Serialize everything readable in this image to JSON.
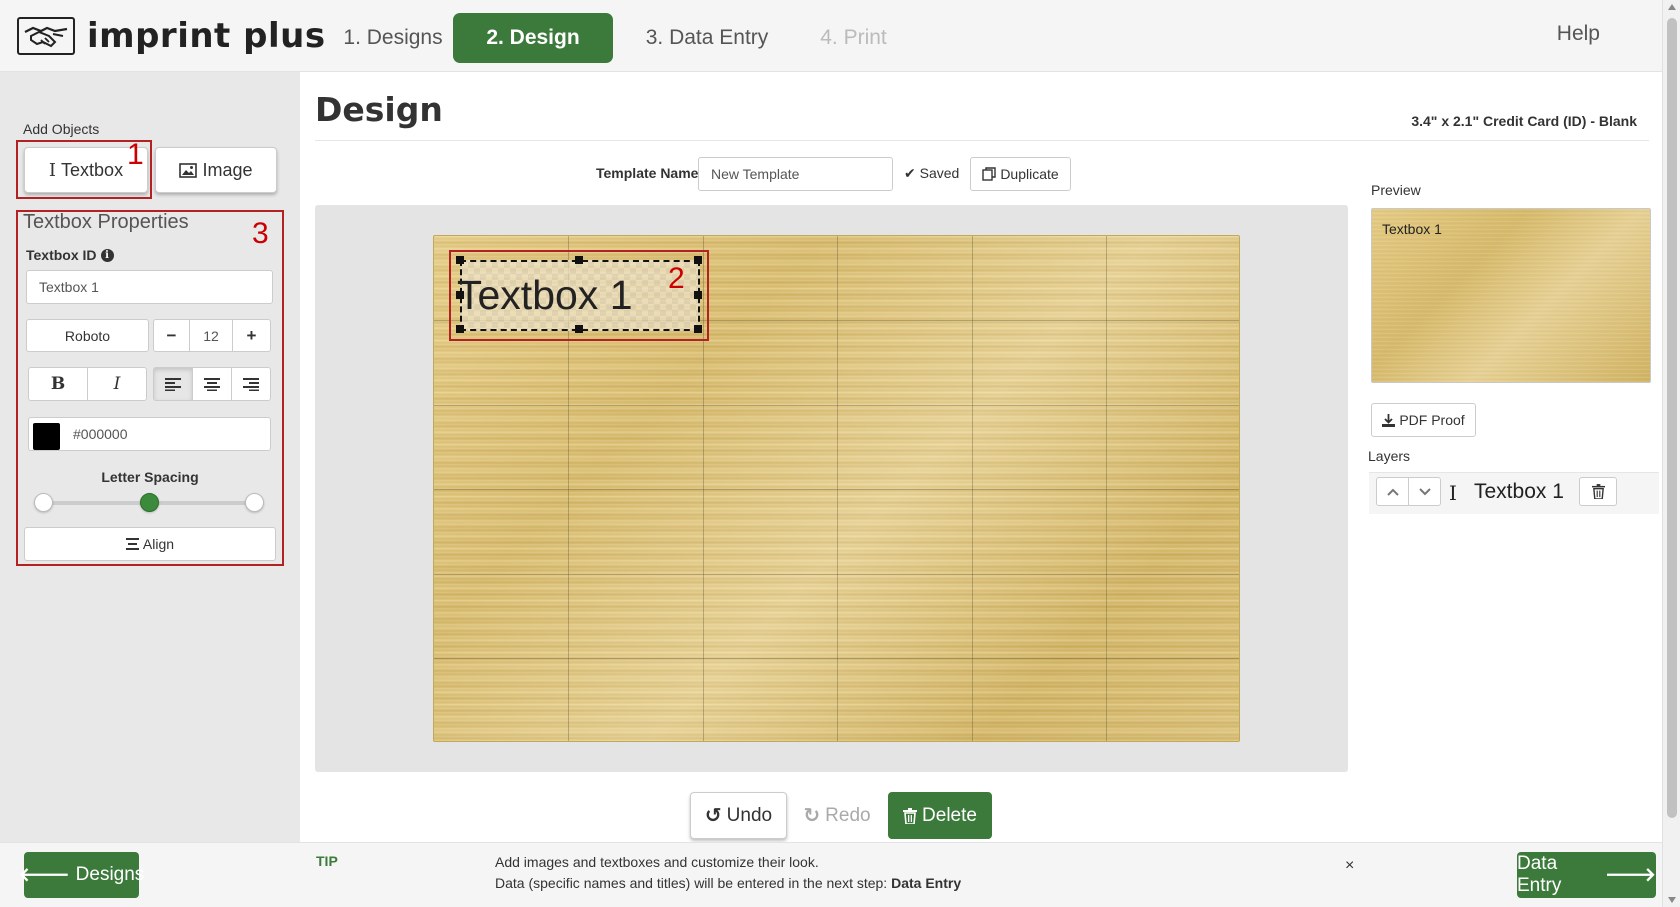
{
  "header": {
    "logo_text": "imprint plus",
    "steps": [
      "1. Designs",
      "2. Design",
      "3. Data Entry",
      "4. Print"
    ],
    "help": "Help"
  },
  "sidebar": {
    "add_objects_label": "Add Objects",
    "textbox_button": "Textbox",
    "image_button": "Image",
    "annotation_1": "1",
    "annotation_3": "3",
    "properties_title": "Textbox Properties",
    "textbox_id_label": "Textbox ID",
    "textbox_id_value": "Textbox 1",
    "font_family": "Roboto",
    "font_size": "12",
    "minus": "−",
    "plus": "+",
    "bold": "B",
    "italic": "I",
    "color_hex": "#000000",
    "letter_spacing_label": "Letter Spacing",
    "letter_spacing_level": 0.5,
    "align_button": "Align"
  },
  "main": {
    "title": "Design",
    "card_spec": "3.4\" x 2.1\" Credit Card (ID) - Blank",
    "template_name_label": "Template Name",
    "template_name_value": "New Template",
    "saved_status": "Saved",
    "duplicate_button": "Duplicate",
    "textbox_text": "Textbox 1",
    "annotation_2": "2",
    "undo_button": "Undo",
    "redo_button": "Redo",
    "delete_button": "Delete"
  },
  "right_panel": {
    "preview_label": "Preview",
    "preview_text": "Textbox 1",
    "pdf_proof_button": "PDF Proof",
    "layers_label": "Layers",
    "layer_name": "Textbox 1"
  },
  "footer": {
    "back_button": "Designs",
    "tip_label": "TIP",
    "tip_line1": "Add images and textboxes and customize their look.",
    "tip_line2_prefix": "Data (specific names and titles) will be entered in the next step: ",
    "tip_line2_bold": "Data Entry",
    "close": "×",
    "next_button": "Data Entry"
  },
  "colors": {
    "brand_green": "#3c7a3c",
    "annotation_red": "#b22222",
    "gold": "#dcc177"
  }
}
